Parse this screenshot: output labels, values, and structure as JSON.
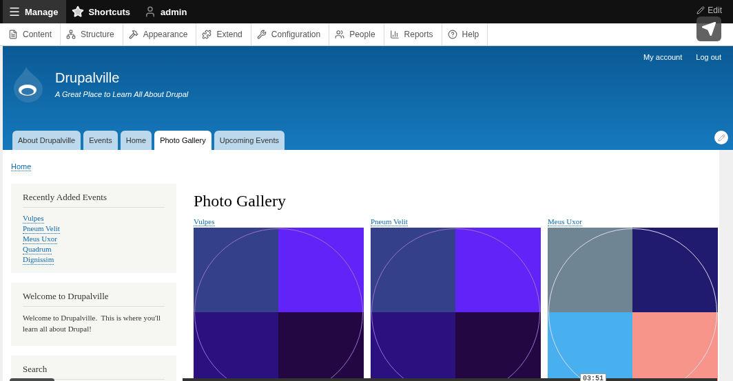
{
  "toolbar": {
    "items": [
      {
        "label": "Manage",
        "selected": true
      },
      {
        "label": "Shortcuts",
        "selected": false
      },
      {
        "label": "admin",
        "selected": false
      }
    ],
    "edit": "Edit"
  },
  "tray": {
    "items": [
      {
        "label": "Content"
      },
      {
        "label": "Structure"
      },
      {
        "label": "Appearance"
      },
      {
        "label": "Extend"
      },
      {
        "label": "Configuration"
      },
      {
        "label": "People"
      },
      {
        "label": "Reports"
      },
      {
        "label": "Help"
      }
    ]
  },
  "header": {
    "user_links": [
      "My account",
      "Log out"
    ],
    "site_name": "Drupalville",
    "slogan": "A Great Place to Learn All About Drupal",
    "tabs": [
      {
        "label": "About Drupalville",
        "selected": false
      },
      {
        "label": "Events",
        "selected": false
      },
      {
        "label": "Home",
        "selected": false
      },
      {
        "label": "Photo Gallery",
        "selected": true
      },
      {
        "label": "Upcoming Events",
        "selected": false
      }
    ]
  },
  "breadcrumb": [
    "Home"
  ],
  "sidebar": {
    "blocks": [
      {
        "kind": "links",
        "title": "Recently Added Events",
        "links": [
          "Vulpes",
          "Pneum Velit",
          "Meus Uxor",
          "Quadrum",
          "Dignissim"
        ]
      },
      {
        "kind": "text",
        "title": "Welcome to Drupalville",
        "body": "Welcome to Drupalville.  This is where you'll learn all about Drupal!"
      },
      {
        "kind": "text",
        "title": "Search"
      }
    ]
  },
  "main": {
    "title": "Photo Gallery",
    "items": [
      {
        "title": "Vulpes"
      },
      {
        "title": "Pneum Velit"
      },
      {
        "title": "Meus Uxor"
      }
    ]
  },
  "recorder": {
    "time": "03:51"
  }
}
